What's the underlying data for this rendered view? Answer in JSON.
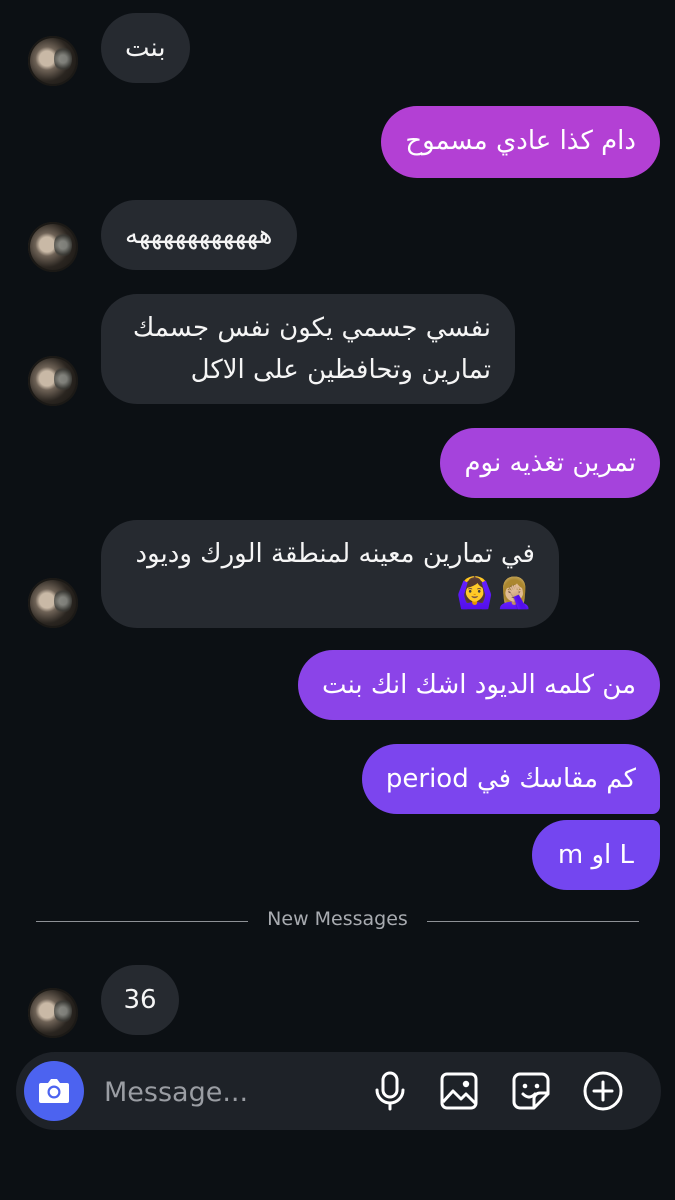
{
  "messages": [
    {
      "dir": "in",
      "text": "بنت"
    },
    {
      "dir": "out",
      "text": "دام كذا عادي مسموح"
    },
    {
      "dir": "in",
      "text": "هههههههههههه"
    },
    {
      "dir": "in",
      "line1": "نفسي جسمي يكون نفس جسمك",
      "line2": "تمارين وتحافظين على الاكل"
    },
    {
      "dir": "out",
      "text": "تمرين تغذيه نوم"
    },
    {
      "dir": "in",
      "line1": "في تمارين معينه لمنطقة الورك وديود",
      "emoji": "🤦🏼‍♀️🙆‍♀️"
    },
    {
      "dir": "out",
      "text": "من كلمه الديود اشك انك بنت"
    },
    {
      "dir": "out",
      "text": "كم مقاسك في period"
    },
    {
      "dir": "out",
      "text": "L او m"
    }
  ],
  "divider": {
    "label": "New Messages"
  },
  "new_messages": [
    {
      "dir": "in",
      "text": "36"
    }
  ],
  "composer": {
    "placeholder": "Message...",
    "icons": [
      "camera-icon",
      "microphone-icon",
      "gallery-icon",
      "sticker-icon",
      "add-icon"
    ]
  },
  "colors": {
    "background": "#0c1014",
    "incoming_bubble": "#262a30",
    "outgoing_gradient_top": "#b63fd6",
    "outgoing_gradient_bottom": "#7a44ee",
    "camera_button": "#4c63f0"
  }
}
